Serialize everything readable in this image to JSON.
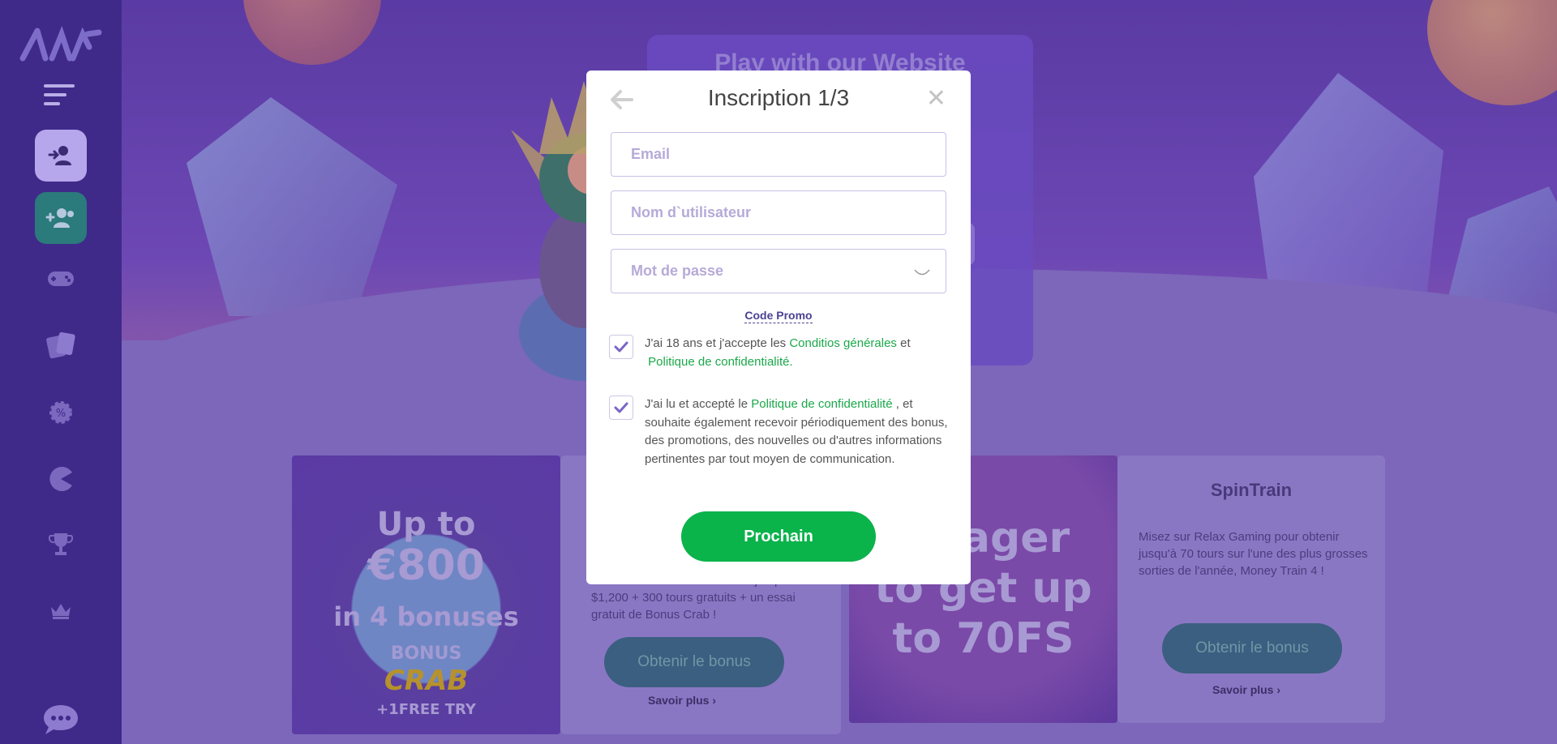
{
  "modal": {
    "title": "Inscription 1/3",
    "email_placeholder": "Email",
    "username_placeholder": "Nom d`utilisateur",
    "password_placeholder": "Mot de passe",
    "promo_code_link": "Code Promo",
    "consent_terms": {
      "checked": true,
      "text_before": "J'ai 18 ans et j'accepte les ",
      "link1": "Conditios générales",
      "text_middle": " et ",
      "link2": "Politique de confidentialité",
      "text_after": "."
    },
    "consent_marketing": {
      "checked": true,
      "text_before": "J'ai lu et accepté le ",
      "link": "Politique de confidentialité",
      "text_after": " , et souhaite également recevoir périodiquement des bonus, des promotions, des nouvelles ou d'autres informations pertinentes par tout moyen de communication."
    },
    "next_button": "Prochain"
  },
  "background": {
    "hero_title": "Play with our Website",
    "promo1": {
      "line1": "Up to",
      "line2": "€800",
      "line3": "in 4 bonuses",
      "line4": "BONUS",
      "line5": "CRAB",
      "line6": "+1FREE TRY"
    },
    "promo2": {
      "description": "Bienvenue à une valeur allant jusqu'à $1,200 + 300 tours gratuits + un essai gratuit de Bonus Crab !",
      "button": "Obtenir le bonus",
      "more": "Savoir plus"
    },
    "promo3": {
      "line1": "ager",
      "line2": "to get up",
      "line3": "to 70FS"
    },
    "promo4": {
      "title": "SpinTrain",
      "description": "Misez sur Relax Gaming pour obtenir jusqu'à 70 tours sur l'une des plus grosses sorties de l'année, Money Train 4 !",
      "button": "Obtenir le bonus",
      "more": "Savoir plus"
    }
  },
  "sidebar": {
    "icons": [
      "logo",
      "menu-icon",
      "login-icon",
      "register-icon",
      "gamepad-icon",
      "cards-icon",
      "promo-gear-icon",
      "pacman-icon",
      "trophy-icon",
      "crown-icon",
      "chat-icon"
    ]
  },
  "colors": {
    "accent_green": "#0bb34b",
    "link_green": "#1ba84a",
    "sidebar": "#3f2a8a",
    "check": "#7a66c7"
  }
}
